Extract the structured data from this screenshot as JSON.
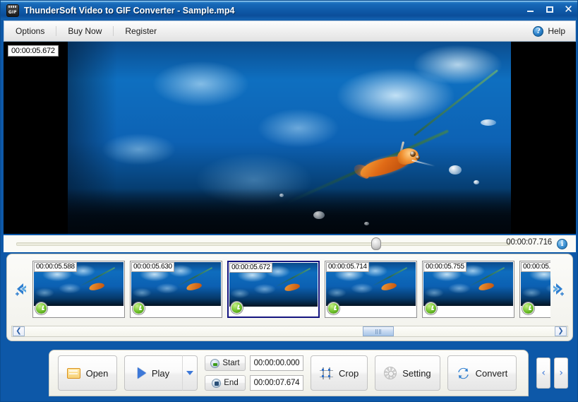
{
  "window": {
    "title": "ThunderSoft Video to GIF Converter - Sample.mp4",
    "icon_name": "gif-app-icon",
    "icon_label": "GIF",
    "minimize_label": "Minimize",
    "maximize_label": "Maximize",
    "close_label": "Close",
    "close_glyph": "✕",
    "accent_color": "#0d58a8"
  },
  "menubar": {
    "items": [
      {
        "label": "Options"
      },
      {
        "label": "Buy Now"
      },
      {
        "label": "Register"
      }
    ],
    "help": {
      "label": "Help",
      "icon": "question-mark-icon",
      "glyph": "?"
    }
  },
  "player": {
    "current_time_overlay": "00:00:05.672",
    "seek": {
      "position_percent": 72,
      "total_time": "00:00:07.716",
      "info_icon": "info-icon",
      "info_glyph": "i"
    }
  },
  "strip": {
    "prev_arrow_name": "strip-prev-arrow",
    "next_arrow_name": "strip-next-arrow",
    "thumbnails": [
      {
        "time": "00:00:05.588",
        "selected": false
      },
      {
        "time": "00:00:05.630",
        "selected": false
      },
      {
        "time": "00:00:05.672",
        "selected": true
      },
      {
        "time": "00:00:05.714",
        "selected": false
      },
      {
        "time": "00:00:05.755",
        "selected": false
      },
      {
        "time": "00:00:05.",
        "selected": false
      }
    ],
    "scrollbar": {
      "left_glyph": "❮",
      "right_glyph": "❯",
      "thumb_position_percent": 63
    },
    "selected_border_color": "#13137f"
  },
  "toolbar": {
    "open_label": "Open",
    "open_icon": "folder-icon",
    "play_label": "Play",
    "play_icon": "play-triangle-icon",
    "play_dropdown_icon": "chevron-down-icon",
    "start_label": "Start",
    "start_icon": "clock-start-icon",
    "start_time": "00:00:00.000",
    "end_label": "End",
    "end_icon": "clock-end-icon",
    "end_time": "00:00:07.674",
    "crop_label": "Crop",
    "crop_icon": "crop-icon",
    "setting_label": "Setting",
    "setting_icon": "gear-icon",
    "convert_label": "Convert",
    "convert_icon": "convert-refresh-icon",
    "prev_glyph": "‹",
    "next_glyph": "›"
  }
}
